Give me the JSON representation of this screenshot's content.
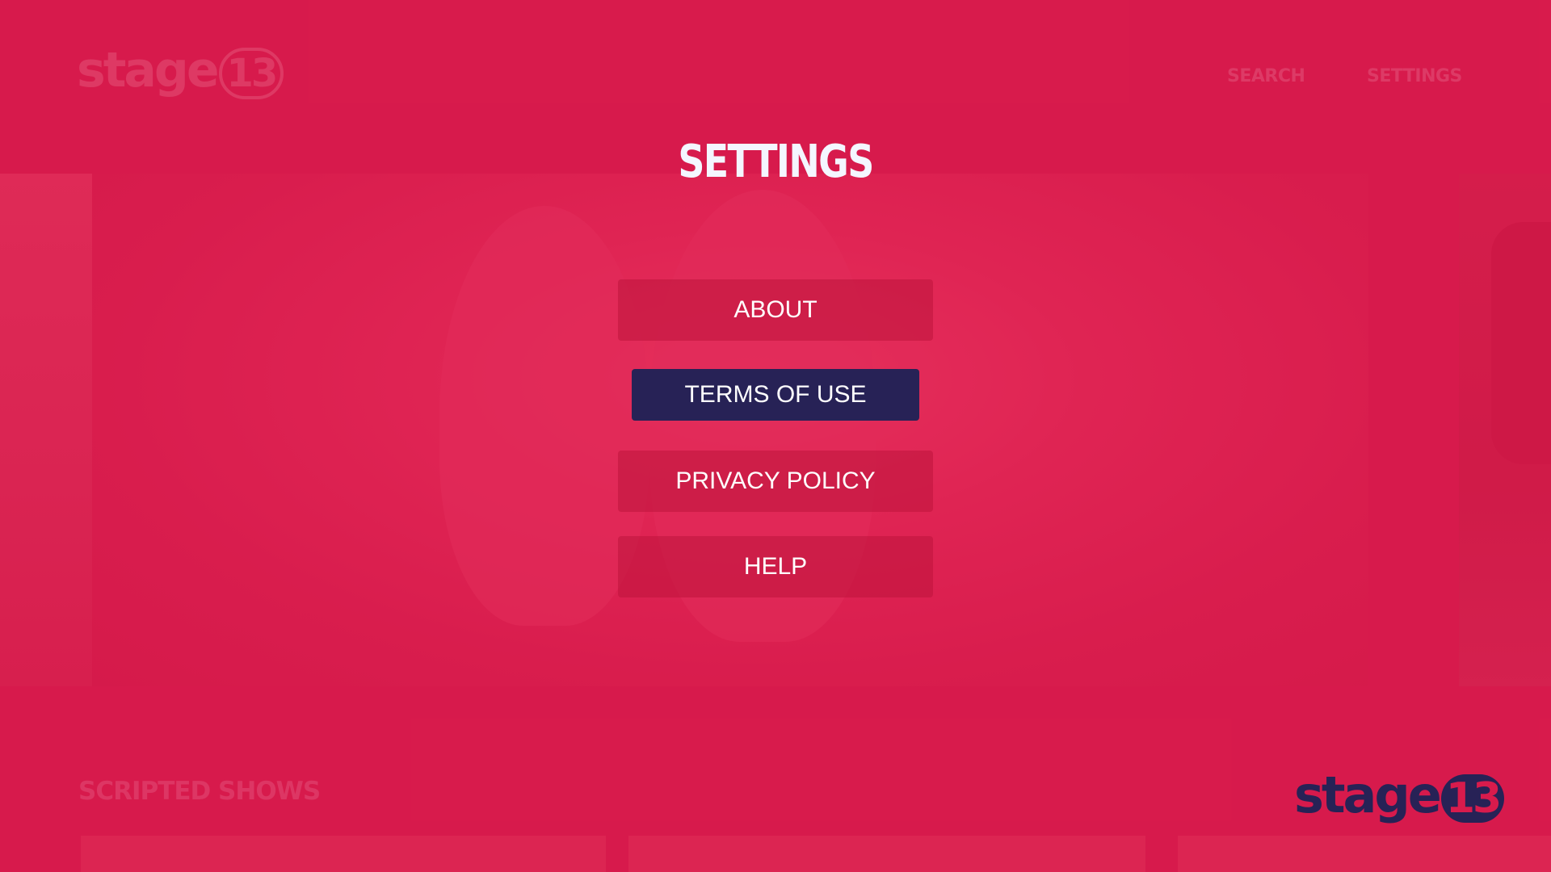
{
  "background": {
    "logo_word": "stage",
    "logo_number": "13",
    "nav": {
      "search_label": "SEARCH",
      "settings_label": "SETTINGS"
    },
    "section_title": "SCRIPTED SHOWS"
  },
  "settings": {
    "title": "SETTINGS",
    "items": [
      {
        "label": "ABOUT",
        "focused": false
      },
      {
        "label": "TERMS OF USE",
        "focused": true
      },
      {
        "label": "PRIVACY POLICY",
        "focused": false
      },
      {
        "label": "HELP",
        "focused": false
      }
    ]
  },
  "brand": {
    "logo_word": "stage",
    "logo_number": "13"
  },
  "colors": {
    "background": "#d81b4c",
    "focused_button": "#272256",
    "title_text": "#f4f6ff",
    "logo": "#272256"
  }
}
